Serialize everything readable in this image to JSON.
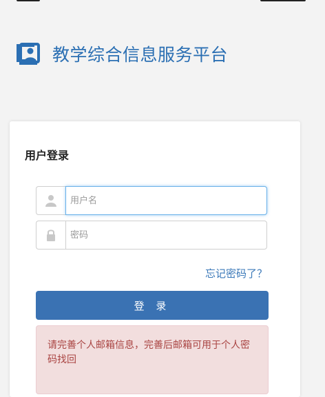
{
  "header": {
    "title": "教学综合信息服务平台",
    "logo_icon": "monitor-user-icon",
    "brand_color": "#2b6fb3"
  },
  "login": {
    "panel_title": "用户登录",
    "username": {
      "placeholder": "用户名",
      "value": "",
      "icon": "user-icon"
    },
    "password": {
      "placeholder": "密码",
      "value": "",
      "icon": "lock-icon"
    },
    "forgot_link": "忘记密码了？",
    "submit_label": "登 录",
    "alert_message": "请完善个人邮箱信息，完善后邮箱可用于个人密码找回"
  },
  "colors": {
    "button": "#3a72b3",
    "link": "#3a78b8",
    "alert_bg": "#f2dede",
    "alert_text": "#a94442"
  }
}
